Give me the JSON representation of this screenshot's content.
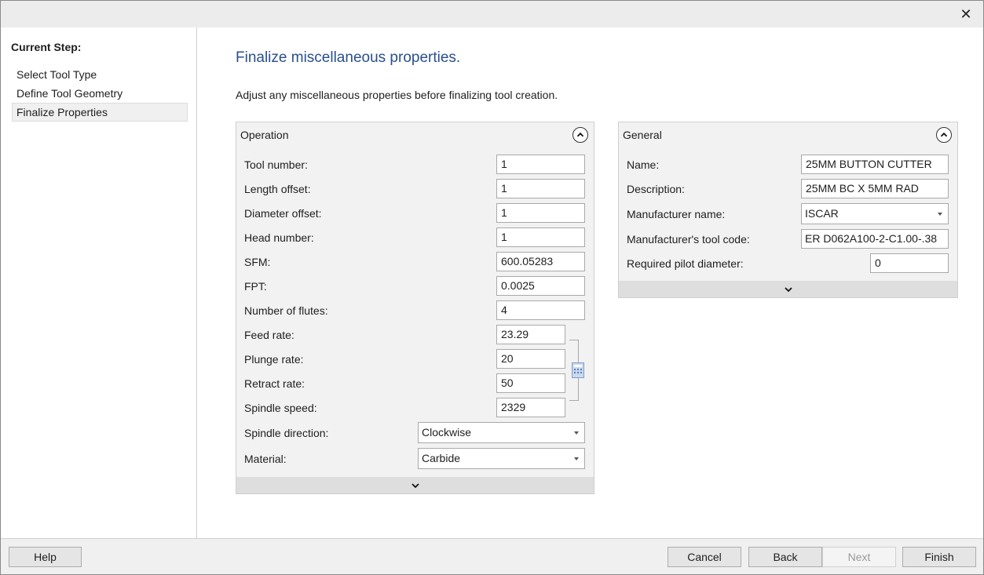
{
  "window": {
    "close_glyph": "✕"
  },
  "sidebar": {
    "heading": "Current Step:",
    "steps": [
      "Select Tool Type",
      "Define Tool Geometry",
      "Finalize Properties"
    ],
    "active_index": 2
  },
  "main": {
    "title": "Finalize miscellaneous properties.",
    "description": "Adjust any miscellaneous properties before finalizing tool creation."
  },
  "operation": {
    "title": "Operation",
    "tool_number": {
      "label": "Tool number:",
      "value": "1"
    },
    "length_offset": {
      "label": "Length offset:",
      "value": "1"
    },
    "diameter_offset": {
      "label": "Diameter offset:",
      "value": "1"
    },
    "head_number": {
      "label": "Head number:",
      "value": "1"
    },
    "sfm": {
      "label": "SFM:",
      "value": "600.05283"
    },
    "fpt": {
      "label": "FPT:",
      "value": "0.0025"
    },
    "number_of_flutes": {
      "label": "Number of flutes:",
      "value": "4"
    },
    "feed_rate": {
      "label": "Feed rate:",
      "value": "23.29"
    },
    "plunge_rate": {
      "label": "Plunge rate:",
      "value": "20"
    },
    "retract_rate": {
      "label": "Retract rate:",
      "value": "50"
    },
    "spindle_speed": {
      "label": "Spindle speed:",
      "value": "2329"
    },
    "spindle_direction": {
      "label": "Spindle direction:",
      "value": "Clockwise"
    },
    "material": {
      "label": "Material:",
      "value": "Carbide"
    }
  },
  "general": {
    "title": "General",
    "name": {
      "label": "Name:",
      "value": "25MM BUTTON CUTTER"
    },
    "description": {
      "label": "Description:",
      "value": "25MM BC X 5MM RAD"
    },
    "manufacturer_name": {
      "label": "Manufacturer name:",
      "value": "ISCAR"
    },
    "manufacturer_tool_code": {
      "label": "Manufacturer's tool code:",
      "value": "ER D062A100-2-C1.00-.38"
    },
    "required_pilot_diameter": {
      "label": "Required pilot diameter:",
      "value": "0"
    }
  },
  "buttons": {
    "help": "Help",
    "cancel": "Cancel",
    "back": "Back",
    "next": "Next",
    "finish": "Finish"
  },
  "icons": {
    "close": "close-icon",
    "collapse": "chevron-up-icon",
    "expand": "chevron-down-icon",
    "calculator": "calculator-icon"
  },
  "colors": {
    "title_blue": "#2a4f8f",
    "panel_bg": "#f2f2f2"
  }
}
